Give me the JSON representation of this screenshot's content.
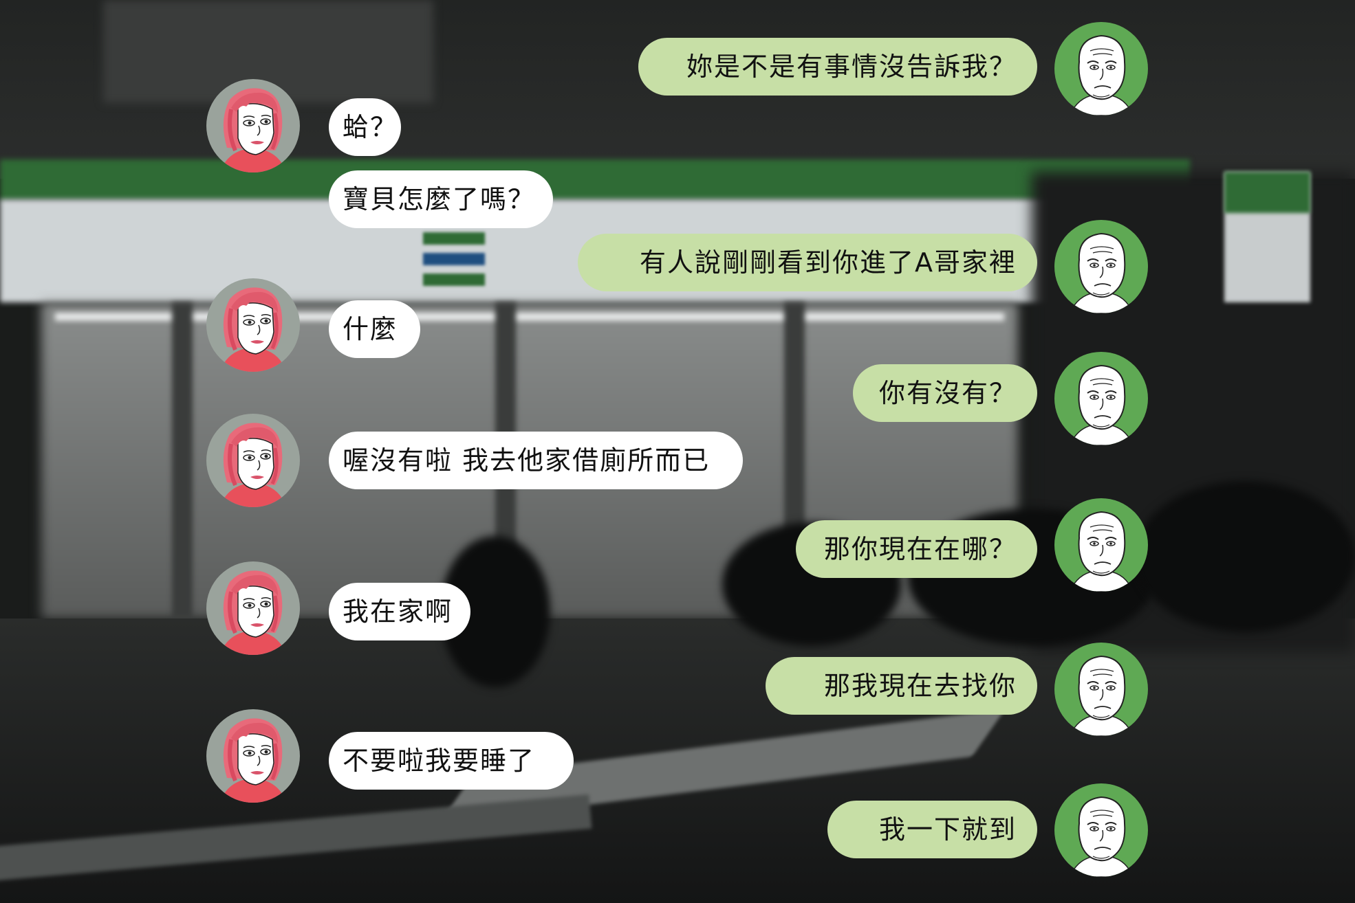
{
  "colors": {
    "girl_bubble": "#ffffff",
    "guy_bubble": "#c7dfa6",
    "girl_avatar_bg": "#9aa39c",
    "guy_avatar_bg": "#5fa954"
  },
  "avatars": {
    "girl_icon": "pink-haired-girl-avatar-icon",
    "guy_icon": "wojak-avatar-icon"
  },
  "messages": [
    {
      "sender": "guy",
      "text": "妳是不是有事情沒告訴我？"
    },
    {
      "sender": "girl",
      "text": "蛤？"
    },
    {
      "sender": "girl",
      "text": "寶貝怎麼了嗎？"
    },
    {
      "sender": "guy",
      "text": "有人說剛剛看到你進了A哥家裡"
    },
    {
      "sender": "girl",
      "text": "什麼"
    },
    {
      "sender": "guy",
      "text": "你有沒有？"
    },
    {
      "sender": "girl",
      "text": "喔沒有啦 我去他家借廁所而已"
    },
    {
      "sender": "guy",
      "text": "那你現在在哪？"
    },
    {
      "sender": "girl",
      "text": "我在家啊"
    },
    {
      "sender": "guy",
      "text": "那我現在去找你"
    },
    {
      "sender": "girl",
      "text": "不要啦我要睡了"
    },
    {
      "sender": "guy",
      "text": "我一下就到"
    }
  ]
}
